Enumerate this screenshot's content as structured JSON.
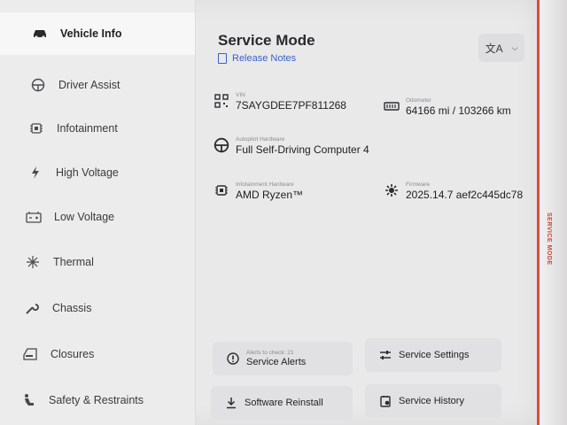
{
  "sidebar": {
    "items": [
      {
        "label": "Vehicle Info",
        "icon": "car-icon"
      },
      {
        "label": "Driver Assist",
        "icon": "steering-wheel-icon"
      },
      {
        "label": "Infotainment",
        "icon": "chip-icon"
      },
      {
        "label": "High Voltage",
        "icon": "bolt-icon"
      },
      {
        "label": "Low Voltage",
        "icon": "battery-icon"
      },
      {
        "label": "Thermal",
        "icon": "snowflake-icon"
      },
      {
        "label": "Chassis",
        "icon": "wrench-icon"
      },
      {
        "label": "Closures",
        "icon": "car-door-icon"
      },
      {
        "label": "Safety & Restraints",
        "icon": "seat-icon"
      }
    ]
  },
  "main": {
    "title": "Service Mode",
    "release_notes": "Release Notes",
    "language_icon": "translate-icon",
    "fields": {
      "vin": {
        "label": "VIN",
        "value": "7SAYGDEE7PF811268"
      },
      "odometer": {
        "label": "Odometer",
        "value": "64166 mi / 103266 km"
      },
      "autopilot": {
        "label": "Autopilot Hardware",
        "value": "Full Self-Driving Computer 4"
      },
      "infotainment": {
        "label": "Infotainment Hardware",
        "value": "AMD Ryzen™"
      },
      "firmware": {
        "label": "Firmware",
        "value": "2025.14.7 aef2c445dc78"
      }
    },
    "buttons": {
      "service_alerts": {
        "sub": "Alerts to check: 21",
        "label": "Service Alerts"
      },
      "service_settings": {
        "label": "Service Settings"
      },
      "software_reinstall": {
        "label": "Software Reinstall"
      },
      "service_history": {
        "label": "Service History"
      }
    }
  },
  "side_tag": "SERVICE MODE",
  "colors": {
    "accent_link": "#3a61c8",
    "side_tag": "#c8463a"
  }
}
